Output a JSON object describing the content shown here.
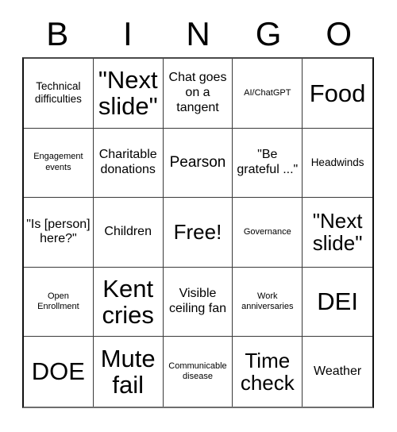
{
  "card": {
    "title": "BINGO",
    "headers": [
      "B",
      "I",
      "N",
      "G",
      "O"
    ],
    "colors": {
      "background": "#ffffff",
      "text": "#000000",
      "grid_line": "#3a3a3a",
      "outer_border": "#111111"
    },
    "free_space": {
      "row": 3,
      "column": 3,
      "label": "Free!"
    },
    "rows": [
      [
        {
          "label": "Technical difficulties",
          "size": "s"
        },
        {
          "label": "\"Next slide\"",
          "size": "xxl"
        },
        {
          "label": "Chat goes on a tangent",
          "size": "m"
        },
        {
          "label": "AI/ChatGPT",
          "size": "xs"
        },
        {
          "label": "Food",
          "size": "xxl"
        }
      ],
      [
        {
          "label": "Engagement events",
          "size": "xs"
        },
        {
          "label": "Charitable donations",
          "size": "m"
        },
        {
          "label": "Pearson",
          "size": "l"
        },
        {
          "label": "\"Be grateful ...\"",
          "size": "m"
        },
        {
          "label": "Headwinds",
          "size": "s"
        }
      ],
      [
        {
          "label": "\"Is [person] here?\"",
          "size": "m"
        },
        {
          "label": "Children",
          "size": "m"
        },
        {
          "label": "Free!",
          "size": "xl"
        },
        {
          "label": "Governance",
          "size": "xs"
        },
        {
          "label": "\"Next slide\"",
          "size": "xl"
        }
      ],
      [
        {
          "label": "Open Enrollment",
          "size": "xs"
        },
        {
          "label": "Kent cries",
          "size": "xxl"
        },
        {
          "label": "Visible ceiling fan",
          "size": "m"
        },
        {
          "label": "Work anniversaries",
          "size": "xs"
        },
        {
          "label": "DEI",
          "size": "xxl"
        }
      ],
      [
        {
          "label": "DOE",
          "size": "xxl"
        },
        {
          "label": "Mute fail",
          "size": "xxl"
        },
        {
          "label": "Communicable disease",
          "size": "xs"
        },
        {
          "label": "Time check",
          "size": "xl"
        },
        {
          "label": "Weather",
          "size": "m"
        }
      ]
    ]
  }
}
